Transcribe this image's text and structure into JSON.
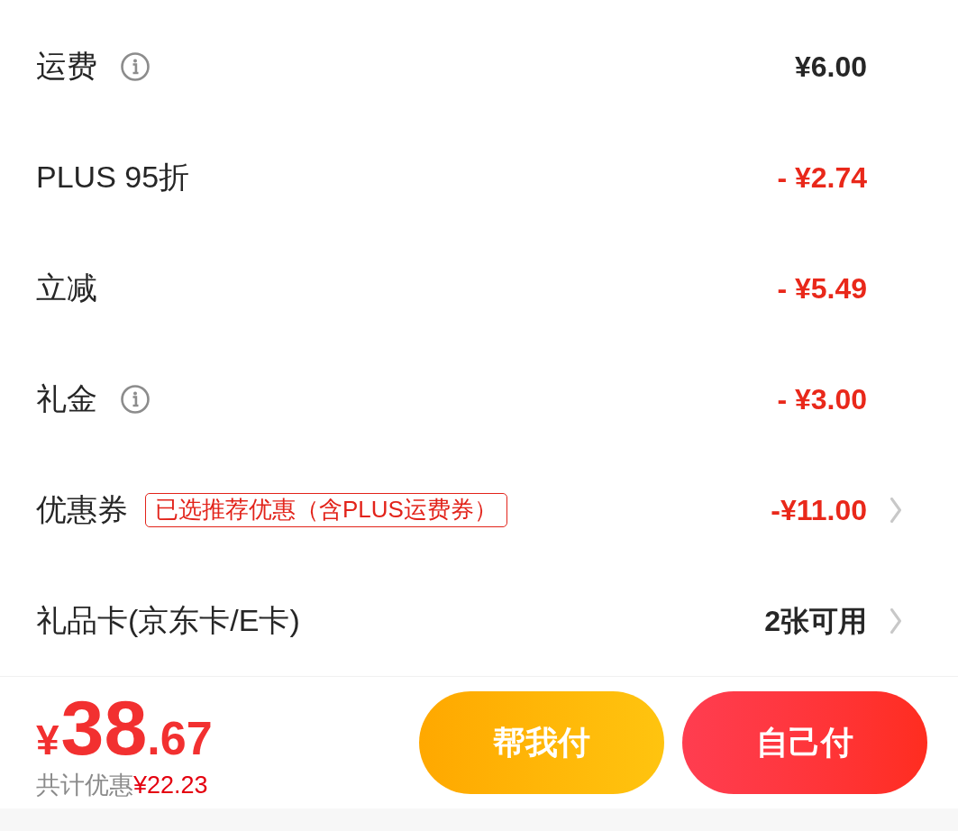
{
  "rows": [
    {
      "label": "运费",
      "info": true,
      "value": "¥6.00",
      "kind": "charge",
      "chevron": false
    },
    {
      "label": "PLUS 95折",
      "info": false,
      "value": "- ¥2.74",
      "kind": "discount",
      "chevron": false
    },
    {
      "label": "立减",
      "info": false,
      "value": "- ¥5.49",
      "kind": "discount",
      "chevron": false
    },
    {
      "label": "礼金",
      "info": true,
      "value": "- ¥3.00",
      "kind": "discount",
      "chevron": false
    },
    {
      "label": "优惠券",
      "info": false,
      "tag": "已选推荐优惠（含PLUS运费券）",
      "value": "-¥11.00",
      "kind": "discount",
      "chevron": true
    },
    {
      "label": "礼品卡(京东卡/E卡)",
      "info": false,
      "value": "2张可用",
      "kind": "count",
      "chevron": true
    }
  ],
  "footer": {
    "total": {
      "currency": "¥",
      "integer": "38",
      "decimal": ".67"
    },
    "savings": {
      "label": "共计优惠",
      "amount": "¥22.23"
    },
    "buttons": [
      {
        "label": "帮我付",
        "kind": "secondary"
      },
      {
        "label": "自己付",
        "kind": "primary"
      }
    ]
  }
}
